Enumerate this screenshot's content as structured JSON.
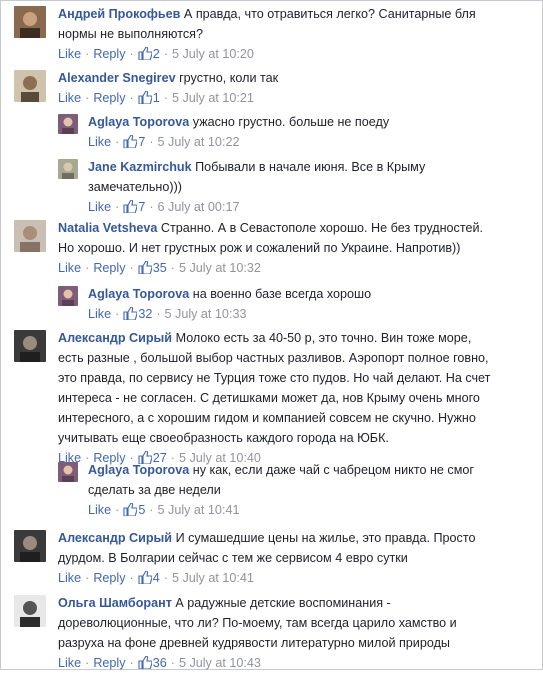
{
  "actions": {
    "like": "Like",
    "reply": "Reply",
    "separator": "·"
  },
  "comments": [
    {
      "author": "Андрей Прокофьев",
      "lines": [
        "А правда, что отравиться легко? Санитарные бля",
        "нормы не выполняются?"
      ],
      "likes": "2",
      "time": "5 July at 10:20",
      "avatar_color": "#8a6a4e"
    },
    {
      "author": "Alexander Snegirev",
      "lines": [
        "грустно, коли так"
      ],
      "likes": "1",
      "time": "5 July at 10:21",
      "avatar_color": "#b9a98f"
    },
    {
      "author": "Aglaya Toporova",
      "lines": [
        "ужасно грустно. больше не поеду"
      ],
      "likes": "7",
      "time": "5 July at 10:22",
      "avatar_color": "#7d5d7a"
    },
    {
      "author": "Jane Kazmirchuk",
      "lines": [
        "Побывали в начале июня. Все в Крыму",
        "замечательно)))"
      ],
      "likes": "7",
      "time": "6 July at 00:17",
      "avatar_color": "#9a9a86"
    },
    {
      "author": "Natalia Vetsheva",
      "lines": [
        "Странно. А в Севастополе хорошо. Не без трудностей.",
        "Но хорошо. И нет грустных рож и сожалений по Украине. Напротив))"
      ],
      "likes": "35",
      "time": "5 July at 10:32",
      "avatar_color": "#b7a99c"
    },
    {
      "author": "Aglaya Toporova",
      "lines": [
        "на военно базе всегда хорошо"
      ],
      "likes": "32",
      "time": "5 July at 10:33",
      "avatar_color": "#7d5d7a"
    },
    {
      "author": "Александр Сирый",
      "lines": [
        "Молоко есть за 40-50 р, это точно. Вин тоже море,",
        "есть разные , большой выбор частных разливов. Аэропорт полное говно,",
        "это правда, по сервису не Турция тоже сто пудов. Но чай делают. На счет",
        "интереса - не согласен. С детишками может да, нов Крыму очень много",
        "интересного, а с хорошим гидом и компанией совсем не скучно. Нужно",
        "учитывать еще своеобразность каждого города на ЮБК."
      ],
      "likes": "27",
      "time": "5 July at 10:40",
      "avatar_color": "#4a4a4a"
    },
    {
      "author": "Aglaya Toporova",
      "lines": [
        "ну как, если даже чай с чабрецом никто не смог",
        "сделать за две недели"
      ],
      "likes": "5",
      "time": "5 July at 10:41",
      "avatar_color": "#7d5d7a"
    },
    {
      "author": "Александр Сирый",
      "lines": [
        "И сумашедшие цены на жилье, это правда. Просто",
        "дурдом. В Болгарии сейчас с тем же сервисом 4 евро сутки"
      ],
      "likes": "4",
      "time": "5 July at 10:41",
      "avatar_color": "#4a4a4a"
    },
    {
      "author": "Ольга Шамборант",
      "lines": [
        "А радужные детские воспоминания -",
        "дореволюционные, что ли? По-моему, там всегда царило хамство и",
        "разруха на фоне древней кудрявости литературно милой природы"
      ],
      "likes": "36",
      "time": "5 July at 10:43",
      "avatar_color": "#6b6b6b"
    }
  ]
}
